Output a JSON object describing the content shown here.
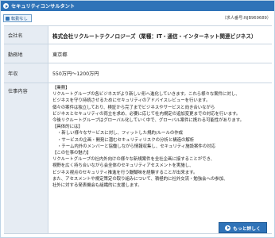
{
  "header": {
    "title": "セキュリティコンサルタント",
    "icon": "arrow-circle-icon"
  },
  "badge": {
    "label": "転勤なし",
    "icon": "square-icon"
  },
  "req_number": "（求人番号:NJB969689）",
  "rows": {
    "company": {
      "label": "会社名",
      "value": "株式会社リクルートテクノロジーズ（業種：IT・通信・インターネット関連ビジネス）"
    },
    "location": {
      "label": "勤務地",
      "value": "東京都"
    },
    "salary": {
      "label": "年収",
      "value": "550万円～1200万円"
    },
    "job": {
      "label": "仕事内容",
      "lines": [
        "【業務】",
        "リクルートグループの各ビジネスがより新しい形へ進化していきます。これら様々な案件に対し、",
        "ビジネスを守り持続させるためにセキュリティのアドバイスレビューを行います。",
        "個々の案件は独立しており、検証から完了までビジネスやサービスと向き合いながら",
        "ビジネスとセキュリティの両立を求め、必要に応じて社内規定の追加変更までの対応を行います。",
        "今後リクルートグループはグローバル化していく中で、グローバル案件に携わる可能性があります。",
        "【具体的には】",
        "・新しい様々なサービスに対し、フィットした規約/ルールの作成",
        "・サービスの企画・開発に潜むセキュリティリスクの分析と構造の解析",
        "・チーム内外のメンバーと協働しながら情報収集し、セキュリティ施設案件の対応",
        "【この仕事の魅力】",
        "リクルートグループの社内外向けの様々な新規案件を全社企画に接することができ、",
        "視野を広く持ち合いながら会全体のセキュリティアセスメントを実施し、",
        "ビジネス視点のセキュリティ推進を行う醍醐味を経験することが出来ます。",
        "また、アセスメントや規定策定の取り組みについて、積極的に社外交流・勉強会への参加、",
        "社外に対する発表機会も組織的に支援します。"
      ]
    }
  },
  "more_button": {
    "label": "もっと詳しく",
    "icon": "arrow-circle-icon"
  }
}
